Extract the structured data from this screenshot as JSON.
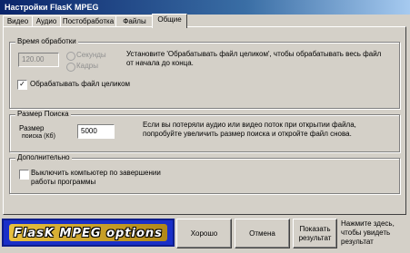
{
  "window": {
    "title": "Настройки FlasK MPEG"
  },
  "tabs": [
    {
      "label": "Видео"
    },
    {
      "label": "Аудио"
    },
    {
      "label": "Постобработка"
    },
    {
      "label": "Файлы"
    },
    {
      "label": "Общие",
      "active": true
    }
  ],
  "processing_time": {
    "legend": "Время обработки",
    "time_value": "120.00",
    "radio_seconds": "Секунды",
    "radio_frames": "Кадры",
    "hint": "Установите 'Обрабатывать файл целиком', чтобы обрабатывать весь файл от начала до конца.",
    "whole_file_label": "Обрабатывать файл целиком",
    "whole_file_checked": true
  },
  "search_size": {
    "legend": "Размер Поиска",
    "label_line1": "Размер",
    "label_line2": "поиска (Кб)",
    "value": "5000",
    "hint": "Если вы потеряли аудио или видео поток при открытии файла, попробуйте увеличить размер поиска и откройте файл снова."
  },
  "additional": {
    "legend": "Дополнительно",
    "shutdown_label": "Выключить компьютер по завершении работы программы",
    "shutdown_checked": false
  },
  "buttons": {
    "ok": "Хорошо",
    "cancel": "Отмена",
    "show_results": "Показать результат"
  },
  "hint_right": "Нажмите здесь, чтобы увидеть результат",
  "logo_text": "FlasK MPEG options"
}
